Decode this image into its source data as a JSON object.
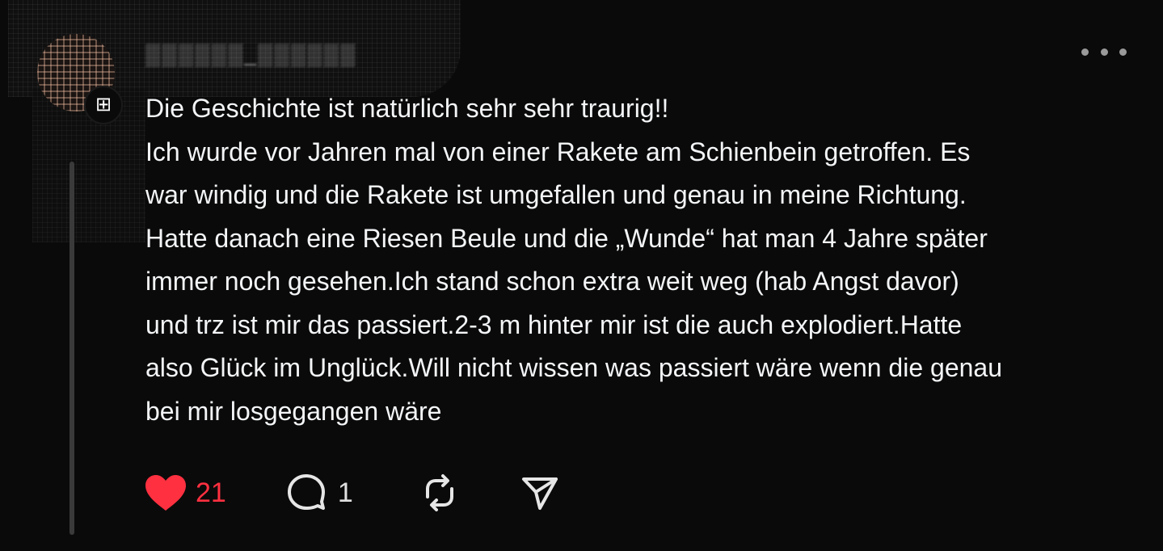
{
  "post": {
    "username": "▒▒▒▒▒▒_▒▒▒▒▒▒",
    "body": "Die Geschichte ist natürlich sehr sehr traurig!!\nIch wurde vor Jahren mal von einer Rakete am Schienbein getroffen. Es\nwar windig und die Rakete ist umgefallen und genau in meine Richtung.\nHatte danach eine Riesen Beule und die „Wunde“ hat man 4 Jahre später\nimmer noch gesehen.Ich stand schon extra weit weg (hab Angst davor)\nund trz ist mir das passiert.2-3 m hinter mir ist die auch explodiert.Hatte\nalso Glück im Unglück.Will nicht wissen was passiert wäre wenn die genau\nbei mir losgegangen wäre",
    "badge_icon": "follow-plus-icon",
    "more_icon": "more-horizontal-icon"
  },
  "actions": {
    "like": {
      "icon": "heart-filled-icon",
      "count": "21",
      "color": "#ff3040",
      "liked": true
    },
    "reply": {
      "icon": "comment-bubble-icon",
      "count": "1"
    },
    "repost": {
      "icon": "repost-icon"
    },
    "share": {
      "icon": "send-icon"
    }
  },
  "colors": {
    "background": "#0a0a0a",
    "text": "#f3f5f7",
    "like_active": "#ff3040",
    "thread_line": "#3a3a3a"
  }
}
